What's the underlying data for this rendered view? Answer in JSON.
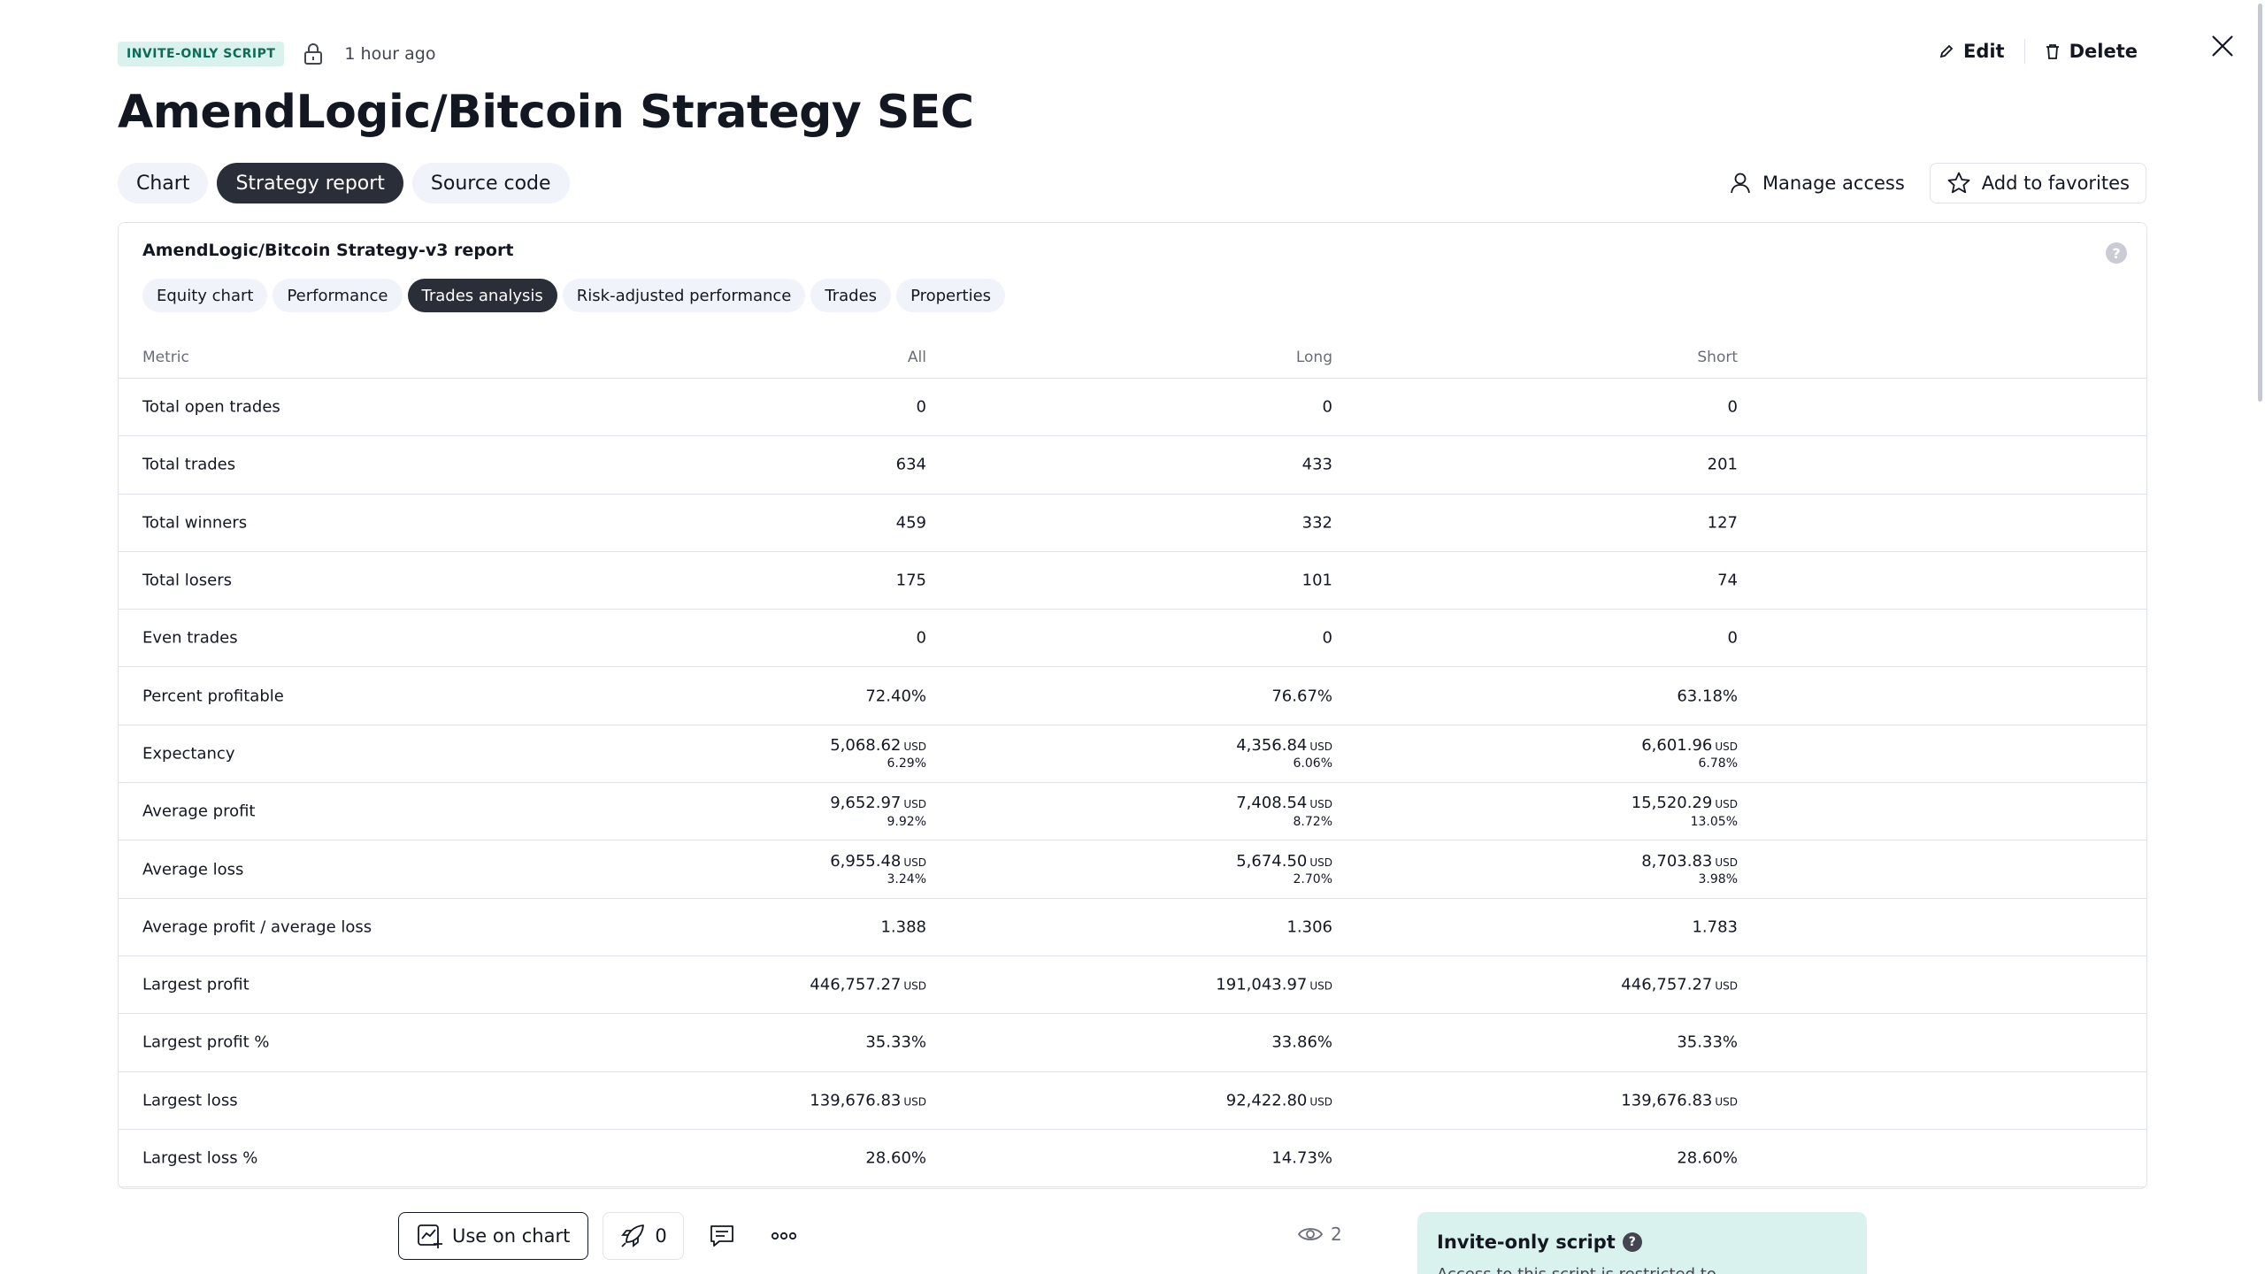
{
  "header": {
    "badge": "INVITE-ONLY SCRIPT",
    "time": "1 hour ago",
    "edit_label": "Edit",
    "delete_label": "Delete"
  },
  "title": "AmendLogic/Bitcoin Strategy SEC",
  "main_tabs": [
    {
      "label": "Chart",
      "active": false
    },
    {
      "label": "Strategy report",
      "active": true
    },
    {
      "label": "Source code",
      "active": false
    }
  ],
  "actions": {
    "manage_access": "Manage access",
    "add_favorites": "Add to favorites"
  },
  "report": {
    "title": "AmendLogic/Bitcoin Strategy-v3 report",
    "help": "?",
    "sub_tabs": [
      {
        "label": "Equity chart",
        "active": false
      },
      {
        "label": "Performance",
        "active": false
      },
      {
        "label": "Trades analysis",
        "active": true
      },
      {
        "label": "Risk-adjusted performance",
        "active": false
      },
      {
        "label": "Trades",
        "active": false
      },
      {
        "label": "Properties",
        "active": false
      }
    ],
    "columns": {
      "metric": "Metric",
      "all": "All",
      "long": "Long",
      "short": "Short"
    },
    "rows": [
      {
        "metric": "Total open trades",
        "all": {
          "v": "0"
        },
        "long": {
          "v": "0"
        },
        "short": {
          "v": "0"
        }
      },
      {
        "metric": "Total trades",
        "all": {
          "v": "634"
        },
        "long": {
          "v": "433"
        },
        "short": {
          "v": "201"
        }
      },
      {
        "metric": "Total winners",
        "all": {
          "v": "459"
        },
        "long": {
          "v": "332"
        },
        "short": {
          "v": "127"
        }
      },
      {
        "metric": "Total losers",
        "all": {
          "v": "175"
        },
        "long": {
          "v": "101"
        },
        "short": {
          "v": "74"
        }
      },
      {
        "metric": "Even trades",
        "all": {
          "v": "0"
        },
        "long": {
          "v": "0"
        },
        "short": {
          "v": "0"
        }
      },
      {
        "metric": "Percent profitable",
        "all": {
          "v": "72.40%"
        },
        "long": {
          "v": "76.67%"
        },
        "short": {
          "v": "63.18%"
        }
      },
      {
        "metric": "Expectancy",
        "all": {
          "v": "5,068.62",
          "u": "USD",
          "p": "6.29%"
        },
        "long": {
          "v": "4,356.84",
          "u": "USD",
          "p": "6.06%"
        },
        "short": {
          "v": "6,601.96",
          "u": "USD",
          "p": "6.78%"
        }
      },
      {
        "metric": "Average profit",
        "all": {
          "v": "9,652.97",
          "u": "USD",
          "p": "9.92%"
        },
        "long": {
          "v": "7,408.54",
          "u": "USD",
          "p": "8.72%"
        },
        "short": {
          "v": "15,520.29",
          "u": "USD",
          "p": "13.05%"
        }
      },
      {
        "metric": "Average loss",
        "all": {
          "v": "6,955.48",
          "u": "USD",
          "p": "3.24%"
        },
        "long": {
          "v": "5,674.50",
          "u": "USD",
          "p": "2.70%"
        },
        "short": {
          "v": "8,703.83",
          "u": "USD",
          "p": "3.98%"
        }
      },
      {
        "metric": "Average profit / average loss",
        "all": {
          "v": "1.388"
        },
        "long": {
          "v": "1.306"
        },
        "short": {
          "v": "1.783"
        }
      },
      {
        "metric": "Largest profit",
        "all": {
          "v": "446,757.27",
          "u": "USD"
        },
        "long": {
          "v": "191,043.97",
          "u": "USD"
        },
        "short": {
          "v": "446,757.27",
          "u": "USD"
        }
      },
      {
        "metric": "Largest profit %",
        "all": {
          "v": "35.33%"
        },
        "long": {
          "v": "33.86%"
        },
        "short": {
          "v": "35.33%"
        }
      },
      {
        "metric": "Largest loss",
        "all": {
          "v": "139,676.83",
          "u": "USD"
        },
        "long": {
          "v": "92,422.80",
          "u": "USD"
        },
        "short": {
          "v": "139,676.83",
          "u": "USD"
        }
      },
      {
        "metric": "Largest loss %",
        "all": {
          "v": "28.60%"
        },
        "long": {
          "v": "14.73%"
        },
        "short": {
          "v": "28.60%"
        }
      }
    ]
  },
  "bottom": {
    "use_on_chart": "Use on chart",
    "boosts": "0",
    "views": "2"
  },
  "invite_panel": {
    "title": "Invite-only script",
    "help": "?",
    "text": "Access to this script is restricted to"
  }
}
